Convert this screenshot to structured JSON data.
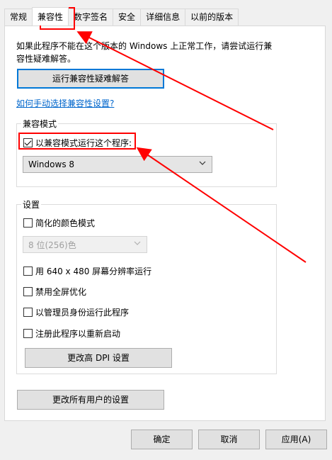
{
  "tabs": [
    "常规",
    "兼容性",
    "数字签名",
    "安全",
    "详细信息",
    "以前的版本"
  ],
  "active_tab": "兼容性",
  "description": "如果此程序不能在这个版本的 Windows 上正常工作，请尝试运行兼容性疑难解答。",
  "troubleshooter_button": "运行兼容性疑难解答",
  "manual_link": "如何手动选择兼容性设置?",
  "compat_mode": {
    "group_title": "兼容模式",
    "checkbox_label": "以兼容模式运行这个程序:",
    "checked": true,
    "selected_os": "Windows 8"
  },
  "settings": {
    "group_title": "设置",
    "reduced_color": {
      "label": "简化的颜色模式",
      "checked": false
    },
    "color_select": "8 位(256)色",
    "res_640": {
      "label": "用 640 x 480 屏幕分辨率运行",
      "checked": false
    },
    "disable_fullscreen": {
      "label": "禁用全屏优化",
      "checked": false
    },
    "run_as_admin": {
      "label": "以管理员身份运行此程序",
      "checked": false
    },
    "register_restart": {
      "label": "注册此程序以重新启动",
      "checked": false
    },
    "dpi_button": "更改高 DPI 设置"
  },
  "all_users_button": "更改所有用户的设置",
  "footer": {
    "ok": "确定",
    "cancel": "取消",
    "apply": "应用(A)"
  },
  "colors": {
    "annotation": "#ff0000",
    "focus": "#0078d7",
    "link": "#0066cc"
  }
}
